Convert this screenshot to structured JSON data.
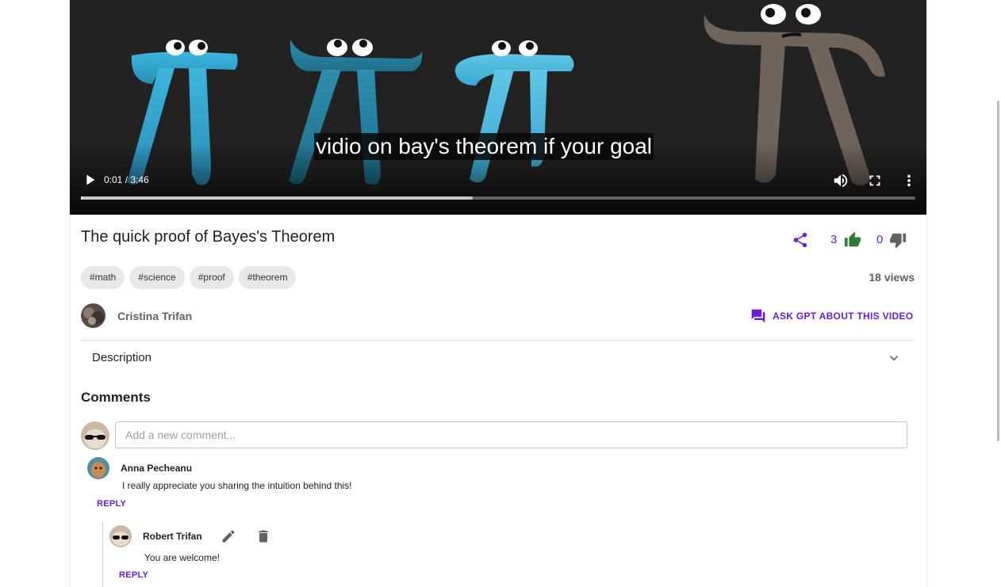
{
  "video": {
    "caption": "vidio on bay's theorem if your goal",
    "time": "0:01 / 3:46",
    "progress_played": 0.001,
    "progress_buffered": 0.47
  },
  "info": {
    "title": "The quick proof of Bayes's Theorem",
    "likes": "3",
    "dislikes": "0",
    "tags": [
      "#math",
      "#science",
      "#proof",
      "#theorem"
    ],
    "views": "18 views",
    "author": "Cristina Trifan",
    "ask_label": "ASK GPT ABOUT THIS VIDEO",
    "description_label": "Description"
  },
  "comments": {
    "heading": "Comments",
    "placeholder": "Add a new comment...",
    "items": [
      {
        "name": "Anna Pecheanu",
        "text": "I really appreciate you sharing the intuition behind this!",
        "reply_label": "REPLY"
      }
    ],
    "replies": [
      {
        "name": "Robert Trifan",
        "text": "You are welcome!",
        "reply_label": "REPLY"
      }
    ]
  },
  "colors": {
    "accent": "#6a1bdb",
    "like_green": "#2e7d32",
    "video_bg": "#222222"
  }
}
